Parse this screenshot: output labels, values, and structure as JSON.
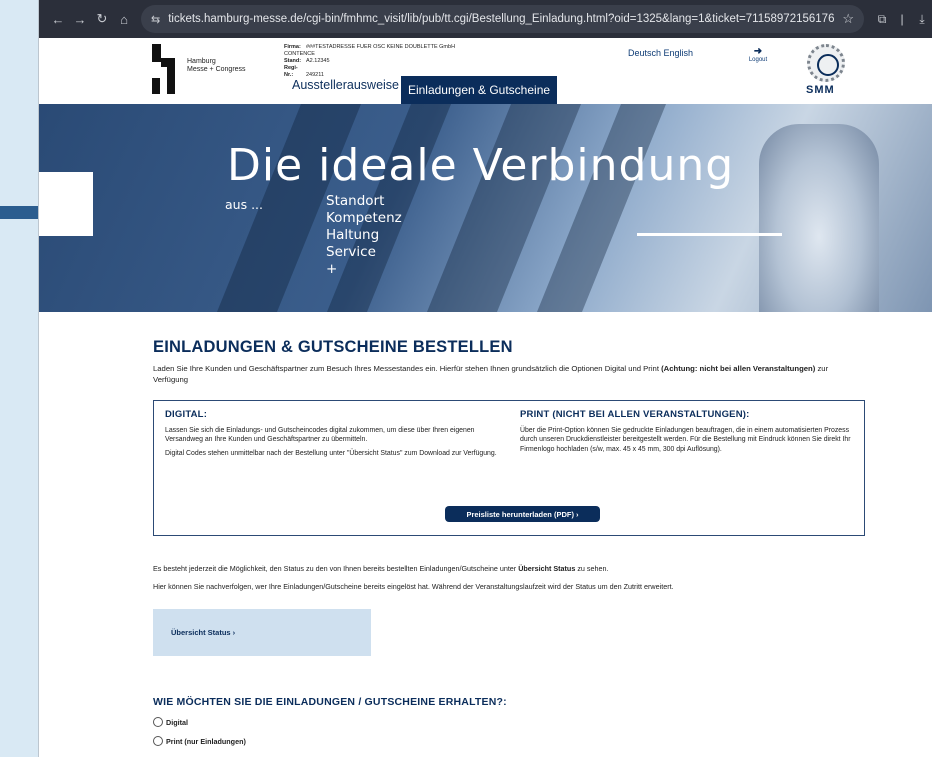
{
  "browser": {
    "url": "tickets.hamburg-messe.de/cgi-bin/fmhmc_visit/lib/pub/tt.cgi/Bestellung_Einladung.html?oid=1325&lang=1&ticket=71158972156176",
    "back": "←",
    "forward": "→",
    "reload": "↻",
    "home": "⌂",
    "site_settings": "⇆",
    "bookmark": "☆",
    "extensions": "⧉",
    "separator": "|",
    "download": "⤓"
  },
  "header": {
    "logo_line1": "Hamburg",
    "logo_line2": "Messe + Congress",
    "firm_label": "Firma:",
    "firm_value": "###TESTADRESSE FUER OSC KEINE DOUBLETTE GmbH",
    "firm_value2": "CONTENCE",
    "stand_label": "Stand:",
    "stand_value": "A2.12345",
    "regi_label": "Regi-Nr.:",
    "regi_value": "249211",
    "lang_de": "Deutsch",
    "lang_en": "English",
    "logout_icon": "➜",
    "logout": "Logout",
    "smm_logo": "SMM",
    "tabs": [
      {
        "label": "Ausstellerausweise"
      },
      {
        "label": "Einladungen & Gutscheine"
      }
    ]
  },
  "hero": {
    "title": "Die ideale Verbindung",
    "aus": "aus ...",
    "words": [
      "Standort",
      "Kompetenz",
      "Haltung",
      "Service",
      "+"
    ]
  },
  "main": {
    "title": "EINLADUNGEN & GUTSCHEINE BESTELLEN",
    "intro_a": "Laden Sie Ihre Kunden und Geschäftspartner zum Besuch Ihres Messestandes ein. Hierfür stehen Ihnen grundsätzlich die Optionen Digital und Print ",
    "intro_b": "(Achtung: nicht bei allen Veranstaltungen)",
    "intro_c": " zur Verfügung",
    "digital_title": "DIGITAL:",
    "digital_p1": "Lassen Sie sich die Einladungs- und Gutscheincodes digital zukommen, um diese über Ihren eigenen Versandweg an Ihre Kunden und Geschäftspartner zu übermitteln.",
    "digital_p2": "Digital Codes stehen unmittelbar nach der Bestellung unter \"Übersicht Status\" zum Download zur Verfügung.",
    "print_title": "PRINT (NICHT BEI ALLEN VERANSTALTUNGEN):",
    "print_p1": "Über die Print-Option können Sie gedruckte Einladungen beauftragen, die in einem automatisierten Prozess durch unseren Druckdienstleister bereitgestellt werden. Für die Bestellung mit Eindruck können Sie direkt Ihr Firmenlogo hochladen (s/w, max. 45 x 45 mm, 300 dpi Auflösung).",
    "pdf_button": "Preisliste herunterladen (PDF)  ›",
    "status_p1_a": "Es besteht jederzeit die Möglichkeit, den Status zu den von Ihnen bereits bestellten Einladungen/Gutscheine unter ",
    "status_p1_b": "Übersicht Status",
    "status_p1_c": " zu sehen.",
    "status_p2": "Hier können Sie nachverfolgen, wer Ihre Einladungen/Gutscheine bereits eingelöst hat. Während der Veranstaltungslaufzeit wird der Status um den Zutritt erweitert.",
    "status_link": "Übersicht Status  ›",
    "receive_title": "WIE MÖCHTEN SIE DIE EINLADUNGEN / GUTSCHEINE ERHALTEN?:",
    "options": [
      {
        "label": "Digital"
      },
      {
        "label": "Print (nur Einladungen)"
      }
    ]
  }
}
